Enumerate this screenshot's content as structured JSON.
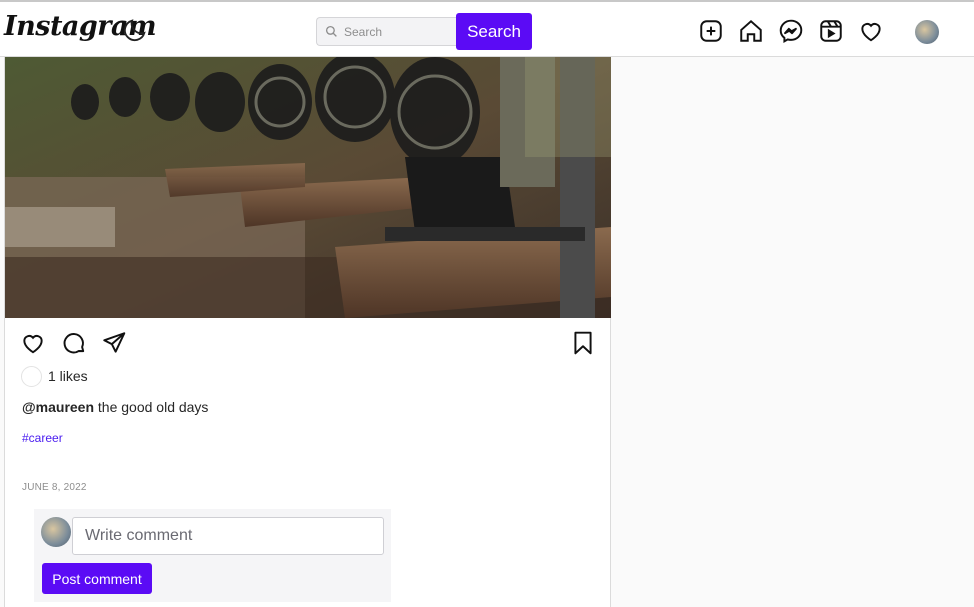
{
  "header": {
    "logo_text": "Instagram",
    "search_placeholder": "Search",
    "search_button_label": "Search",
    "nav_icons": [
      "add-post-icon",
      "home-icon",
      "messenger-icon",
      "reels-icon",
      "heart-icon"
    ]
  },
  "post": {
    "image_description_icon": "photo",
    "likes_text": "1 likes",
    "caption_user": "@maureen",
    "caption_text": " the good old days",
    "hashtag": "#career",
    "date": "JUNE 8, 2022"
  },
  "comment": {
    "placeholder": "Write comment",
    "post_button_label": "Post comment"
  },
  "colors": {
    "accent": "#5b0bf5",
    "hashtag": "#4b1ef0"
  }
}
